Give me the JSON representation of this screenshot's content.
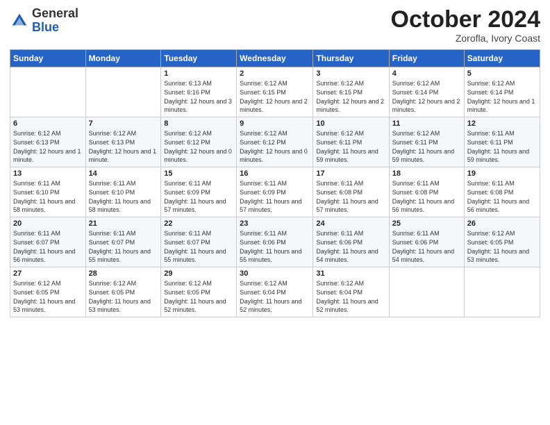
{
  "logo": {
    "general": "General",
    "blue": "Blue"
  },
  "header": {
    "month": "October 2024",
    "location": "Zorofla, Ivory Coast"
  },
  "days_of_week": [
    "Sunday",
    "Monday",
    "Tuesday",
    "Wednesday",
    "Thursday",
    "Friday",
    "Saturday"
  ],
  "weeks": [
    [
      {
        "day": "",
        "sunrise": "",
        "sunset": "",
        "daylight": ""
      },
      {
        "day": "",
        "sunrise": "",
        "sunset": "",
        "daylight": ""
      },
      {
        "day": "1",
        "sunrise": "Sunrise: 6:13 AM",
        "sunset": "Sunset: 6:16 PM",
        "daylight": "Daylight: 12 hours and 3 minutes."
      },
      {
        "day": "2",
        "sunrise": "Sunrise: 6:12 AM",
        "sunset": "Sunset: 6:15 PM",
        "daylight": "Daylight: 12 hours and 2 minutes."
      },
      {
        "day": "3",
        "sunrise": "Sunrise: 6:12 AM",
        "sunset": "Sunset: 6:15 PM",
        "daylight": "Daylight: 12 hours and 2 minutes."
      },
      {
        "day": "4",
        "sunrise": "Sunrise: 6:12 AM",
        "sunset": "Sunset: 6:14 PM",
        "daylight": "Daylight: 12 hours and 2 minutes."
      },
      {
        "day": "5",
        "sunrise": "Sunrise: 6:12 AM",
        "sunset": "Sunset: 6:14 PM",
        "daylight": "Daylight: 12 hours and 1 minute."
      }
    ],
    [
      {
        "day": "6",
        "sunrise": "Sunrise: 6:12 AM",
        "sunset": "Sunset: 6:13 PM",
        "daylight": "Daylight: 12 hours and 1 minute."
      },
      {
        "day": "7",
        "sunrise": "Sunrise: 6:12 AM",
        "sunset": "Sunset: 6:13 PM",
        "daylight": "Daylight: 12 hours and 1 minute."
      },
      {
        "day": "8",
        "sunrise": "Sunrise: 6:12 AM",
        "sunset": "Sunset: 6:12 PM",
        "daylight": "Daylight: 12 hours and 0 minutes."
      },
      {
        "day": "9",
        "sunrise": "Sunrise: 6:12 AM",
        "sunset": "Sunset: 6:12 PM",
        "daylight": "Daylight: 12 hours and 0 minutes."
      },
      {
        "day": "10",
        "sunrise": "Sunrise: 6:12 AM",
        "sunset": "Sunset: 6:11 PM",
        "daylight": "Daylight: 11 hours and 59 minutes."
      },
      {
        "day": "11",
        "sunrise": "Sunrise: 6:12 AM",
        "sunset": "Sunset: 6:11 PM",
        "daylight": "Daylight: 11 hours and 59 minutes."
      },
      {
        "day": "12",
        "sunrise": "Sunrise: 6:11 AM",
        "sunset": "Sunset: 6:11 PM",
        "daylight": "Daylight: 11 hours and 59 minutes."
      }
    ],
    [
      {
        "day": "13",
        "sunrise": "Sunrise: 6:11 AM",
        "sunset": "Sunset: 6:10 PM",
        "daylight": "Daylight: 11 hours and 58 minutes."
      },
      {
        "day": "14",
        "sunrise": "Sunrise: 6:11 AM",
        "sunset": "Sunset: 6:10 PM",
        "daylight": "Daylight: 11 hours and 58 minutes."
      },
      {
        "day": "15",
        "sunrise": "Sunrise: 6:11 AM",
        "sunset": "Sunset: 6:09 PM",
        "daylight": "Daylight: 11 hours and 57 minutes."
      },
      {
        "day": "16",
        "sunrise": "Sunrise: 6:11 AM",
        "sunset": "Sunset: 6:09 PM",
        "daylight": "Daylight: 11 hours and 57 minutes."
      },
      {
        "day": "17",
        "sunrise": "Sunrise: 6:11 AM",
        "sunset": "Sunset: 6:08 PM",
        "daylight": "Daylight: 11 hours and 57 minutes."
      },
      {
        "day": "18",
        "sunrise": "Sunrise: 6:11 AM",
        "sunset": "Sunset: 6:08 PM",
        "daylight": "Daylight: 11 hours and 56 minutes."
      },
      {
        "day": "19",
        "sunrise": "Sunrise: 6:11 AM",
        "sunset": "Sunset: 6:08 PM",
        "daylight": "Daylight: 11 hours and 56 minutes."
      }
    ],
    [
      {
        "day": "20",
        "sunrise": "Sunrise: 6:11 AM",
        "sunset": "Sunset: 6:07 PM",
        "daylight": "Daylight: 11 hours and 56 minutes."
      },
      {
        "day": "21",
        "sunrise": "Sunrise: 6:11 AM",
        "sunset": "Sunset: 6:07 PM",
        "daylight": "Daylight: 11 hours and 55 minutes."
      },
      {
        "day": "22",
        "sunrise": "Sunrise: 6:11 AM",
        "sunset": "Sunset: 6:07 PM",
        "daylight": "Daylight: 11 hours and 55 minutes."
      },
      {
        "day": "23",
        "sunrise": "Sunrise: 6:11 AM",
        "sunset": "Sunset: 6:06 PM",
        "daylight": "Daylight: 11 hours and 55 minutes."
      },
      {
        "day": "24",
        "sunrise": "Sunrise: 6:11 AM",
        "sunset": "Sunset: 6:06 PM",
        "daylight": "Daylight: 11 hours and 54 minutes."
      },
      {
        "day": "25",
        "sunrise": "Sunrise: 6:11 AM",
        "sunset": "Sunset: 6:06 PM",
        "daylight": "Daylight: 11 hours and 54 minutes."
      },
      {
        "day": "26",
        "sunrise": "Sunrise: 6:12 AM",
        "sunset": "Sunset: 6:05 PM",
        "daylight": "Daylight: 11 hours and 53 minutes."
      }
    ],
    [
      {
        "day": "27",
        "sunrise": "Sunrise: 6:12 AM",
        "sunset": "Sunset: 6:05 PM",
        "daylight": "Daylight: 11 hours and 53 minutes."
      },
      {
        "day": "28",
        "sunrise": "Sunrise: 6:12 AM",
        "sunset": "Sunset: 6:05 PM",
        "daylight": "Daylight: 11 hours and 53 minutes."
      },
      {
        "day": "29",
        "sunrise": "Sunrise: 6:12 AM",
        "sunset": "Sunset: 6:05 PM",
        "daylight": "Daylight: 11 hours and 52 minutes."
      },
      {
        "day": "30",
        "sunrise": "Sunrise: 6:12 AM",
        "sunset": "Sunset: 6:04 PM",
        "daylight": "Daylight: 11 hours and 52 minutes."
      },
      {
        "day": "31",
        "sunrise": "Sunrise: 6:12 AM",
        "sunset": "Sunset: 6:04 PM",
        "daylight": "Daylight: 11 hours and 52 minutes."
      },
      {
        "day": "",
        "sunrise": "",
        "sunset": "",
        "daylight": ""
      },
      {
        "day": "",
        "sunrise": "",
        "sunset": "",
        "daylight": ""
      }
    ]
  ]
}
